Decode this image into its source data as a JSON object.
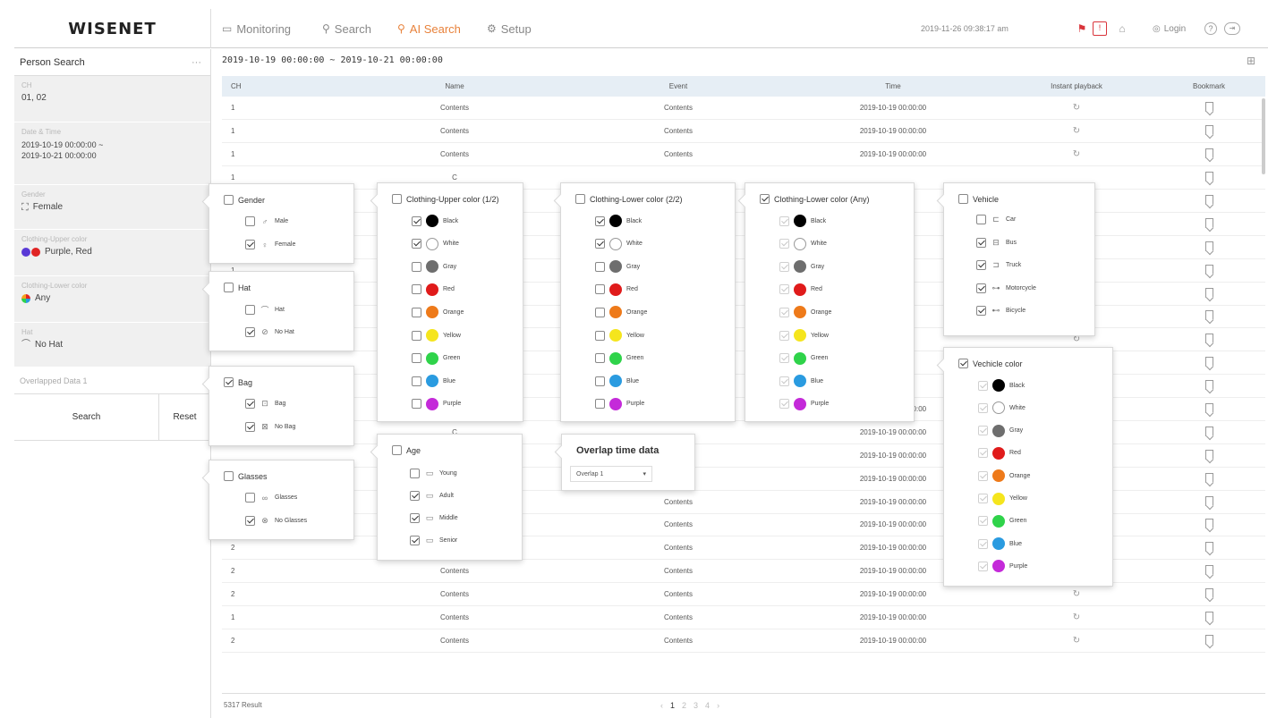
{
  "brand": "WISENET",
  "nav": {
    "monitoring": "Monitoring",
    "search": "Search",
    "ai_search": "AI Search",
    "setup": "Setup"
  },
  "header": {
    "datetime": "2019-11-26 09:38:17 am",
    "login": "Login"
  },
  "sidebar": {
    "title": "Person Search",
    "more": "···",
    "groups": [
      {
        "label": "CH",
        "value": "01, 02"
      },
      {
        "label": "Date & Time",
        "value": "2019-10-19 00:00:00 ~",
        "value2": "2019-10-21 00:00:00"
      },
      {
        "label": "Gender",
        "value": "Female",
        "icon": "person-icon"
      },
      {
        "label": "Clothing-Upper color",
        "value": "Purple, Red",
        "colors": [
          "#7b3fbf",
          "#e02424"
        ]
      },
      {
        "label": "Clothing-Lower color",
        "value": "Any",
        "icon": "color-wheel-icon"
      },
      {
        "label": "Hat",
        "value": "No Hat",
        "icon": "hat-icon"
      }
    ],
    "overlapped": "Overlapped Data 1",
    "search_button": "Search",
    "reset_button": "Reset"
  },
  "main": {
    "range": "2019-10-19 00:00:00 ~ 2019-10-21 00:00:00",
    "columns": [
      "CH",
      "Name",
      "Event",
      "Time",
      "Instant playback",
      "Bookmark"
    ],
    "rows": [
      {
        "ch": "1",
        "name": "Contents",
        "event": "Contents",
        "time": "2019-10-19 00:00:00",
        "playback": true
      },
      {
        "ch": "1",
        "name": "Contents",
        "event": "Contents",
        "time": "2019-10-19 00:00:00",
        "playback": true
      },
      {
        "ch": "1",
        "name": "Contents",
        "event": "Contents",
        "time": "2019-10-19 00:00:00",
        "playback": true
      },
      {
        "ch": "1",
        "name": "C",
        "event": "",
        "time": "",
        "playback": false
      },
      {
        "ch": "",
        "name": "C",
        "event": "",
        "time": "",
        "playback": false
      },
      {
        "ch": "",
        "name": "C",
        "event": "",
        "time": "",
        "playback": false
      },
      {
        "ch": "",
        "name": "C",
        "event": "",
        "time": "",
        "playback": false
      },
      {
        "ch": "1",
        "name": "C",
        "event": "",
        "time": "",
        "playback": false
      },
      {
        "ch": "",
        "name": "C",
        "event": "",
        "time": "",
        "playback": false
      },
      {
        "ch": "",
        "name": "C",
        "event": "",
        "time": "",
        "playback": false
      },
      {
        "ch": "",
        "name": "C",
        "event": "",
        "time": "",
        "playback": true
      },
      {
        "ch": "",
        "name": "C",
        "event": "",
        "time": "",
        "playback": true
      },
      {
        "ch": "",
        "name": "C",
        "event": "",
        "time": "",
        "playback": true
      },
      {
        "ch": "",
        "name": "Contents",
        "event": "Contents",
        "time": "2019-10-19 00:00:00",
        "playback": false
      },
      {
        "ch": "",
        "name": "C",
        "event": "",
        "time": "2019-10-19 00:00:00",
        "playback": false
      },
      {
        "ch": "",
        "name": "C",
        "event": "",
        "time": "2019-10-19 00:00:00",
        "playback": false
      },
      {
        "ch": "",
        "name": "C",
        "event": "Contents",
        "time": "2019-10-19 00:00:00",
        "playback": false
      },
      {
        "ch": "",
        "name": "C",
        "event": "Contents",
        "time": "2019-10-19 00:00:00",
        "playback": false
      },
      {
        "ch": "2",
        "name": "C",
        "event": "Contents",
        "time": "2019-10-19 00:00:00",
        "playback": false
      },
      {
        "ch": "2",
        "name": "Contents",
        "event": "Contents",
        "time": "2019-10-19 00:00:00",
        "playback": false
      },
      {
        "ch": "2",
        "name": "Contents",
        "event": "Contents",
        "time": "2019-10-19 00:00:00",
        "playback": true
      },
      {
        "ch": "2",
        "name": "Contents",
        "event": "Contents",
        "time": "2019-10-19 00:00:00",
        "playback": true
      },
      {
        "ch": "1",
        "name": "Contents",
        "event": "Contents",
        "time": "2019-10-19 00:00:00",
        "playback": true
      },
      {
        "ch": "2",
        "name": "Contents",
        "event": "Contents",
        "time": "2019-10-19 00:00:00",
        "playback": true
      }
    ],
    "result_count": "5317 Result",
    "pages": [
      "‹",
      "1",
      "2",
      "3",
      "4",
      "›"
    ]
  },
  "popups": {
    "gender": {
      "title": "Gender",
      "checked": false,
      "options": [
        {
          "label": "Male",
          "checked": false,
          "icon": "male-icon"
        },
        {
          "label": "Female",
          "checked": true,
          "icon": "female-icon"
        }
      ]
    },
    "hat": {
      "title": "Hat",
      "checked": false,
      "options": [
        {
          "label": "Hat",
          "checked": false,
          "icon": "hat-icon"
        },
        {
          "label": "No Hat",
          "checked": true,
          "icon": "no-hat-icon"
        }
      ]
    },
    "bag": {
      "title": "Bag",
      "checked": true,
      "options": [
        {
          "label": "Bag",
          "checked": true,
          "icon": "bag-icon"
        },
        {
          "label": "No Bag",
          "checked": true,
          "icon": "no-bag-icon"
        }
      ]
    },
    "glasses": {
      "title": "Glasses",
      "checked": false,
      "options": [
        {
          "label": "Glasses",
          "checked": false,
          "icon": "glasses-icon"
        },
        {
          "label": "No Glasses",
          "checked": true,
          "icon": "no-glasses-icon"
        }
      ]
    },
    "upper_color": {
      "title": "Clothing-Upper color (1/2)",
      "checked": false,
      "options": [
        {
          "label": "Black",
          "checked": true,
          "color": "#000000"
        },
        {
          "label": "White",
          "checked": true,
          "color": "#ffffff"
        },
        {
          "label": "Gray",
          "checked": false,
          "color": "#6e6e6e"
        },
        {
          "label": "Red",
          "checked": false,
          "color": "#e01b1b"
        },
        {
          "label": "Orange",
          "checked": false,
          "color": "#ee7a1a"
        },
        {
          "label": "Yellow",
          "checked": false,
          "color": "#f5e51d"
        },
        {
          "label": "Green",
          "checked": false,
          "color": "#2fd34a"
        },
        {
          "label": "Blue",
          "checked": false,
          "color": "#2a9be0"
        },
        {
          "label": "Purple",
          "checked": false,
          "color": "#c42ad9"
        }
      ]
    },
    "lower_color": {
      "title": "Clothing-Lower color (2/2)",
      "checked": false,
      "options": [
        {
          "label": "Black",
          "checked": true,
          "color": "#000000"
        },
        {
          "label": "White",
          "checked": true,
          "color": "#ffffff"
        },
        {
          "label": "Gray",
          "checked": false,
          "color": "#6e6e6e"
        },
        {
          "label": "Red",
          "checked": false,
          "color": "#e01b1b"
        },
        {
          "label": "Orange",
          "checked": false,
          "color": "#ee7a1a"
        },
        {
          "label": "Yellow",
          "checked": false,
          "color": "#f5e51d"
        },
        {
          "label": "Green",
          "checked": false,
          "color": "#2fd34a"
        },
        {
          "label": "Blue",
          "checked": false,
          "color": "#2a9be0"
        },
        {
          "label": "Purple",
          "checked": false,
          "color": "#c42ad9"
        }
      ]
    },
    "lower_color_any": {
      "title": "Clothing-Lower color (Any)",
      "checked": true,
      "options": [
        {
          "label": "Black",
          "checked": true,
          "color": "#000000"
        },
        {
          "label": "White",
          "checked": true,
          "color": "#ffffff"
        },
        {
          "label": "Gray",
          "checked": true,
          "color": "#6e6e6e"
        },
        {
          "label": "Red",
          "checked": true,
          "color": "#e01b1b"
        },
        {
          "label": "Orange",
          "checked": true,
          "color": "#ee7a1a"
        },
        {
          "label": "Yellow",
          "checked": true,
          "color": "#f5e51d"
        },
        {
          "label": "Green",
          "checked": true,
          "color": "#2fd34a"
        },
        {
          "label": "Blue",
          "checked": true,
          "color": "#2a9be0"
        },
        {
          "label": "Purple",
          "checked": true,
          "color": "#c42ad9"
        }
      ]
    },
    "vehicle": {
      "title": "Vehicle",
      "checked": false,
      "options": [
        {
          "label": "Car",
          "checked": false,
          "icon": "car-icon"
        },
        {
          "label": "Bus",
          "checked": true,
          "icon": "bus-icon"
        },
        {
          "label": "Truck",
          "checked": true,
          "icon": "truck-icon"
        },
        {
          "label": "Motorcycle",
          "checked": true,
          "icon": "motorcycle-icon"
        },
        {
          "label": "Bicycle",
          "checked": true,
          "icon": "bicycle-icon"
        }
      ]
    },
    "vehicle_color": {
      "title": "Vechicle color",
      "checked": true,
      "options": [
        {
          "label": "Black",
          "checked": true,
          "color": "#000000"
        },
        {
          "label": "White",
          "checked": true,
          "color": "#ffffff"
        },
        {
          "label": "Gray",
          "checked": true,
          "color": "#6e6e6e"
        },
        {
          "label": "Red",
          "checked": true,
          "color": "#e01b1b"
        },
        {
          "label": "Orange",
          "checked": true,
          "color": "#ee7a1a"
        },
        {
          "label": "Yellow",
          "checked": true,
          "color": "#f5e51d"
        },
        {
          "label": "Green",
          "checked": true,
          "color": "#2fd34a"
        },
        {
          "label": "Blue",
          "checked": true,
          "color": "#2a9be0"
        },
        {
          "label": "Purple",
          "checked": true,
          "color": "#c42ad9"
        }
      ]
    },
    "age": {
      "title": "Age",
      "checked": false,
      "options": [
        {
          "label": "Young",
          "checked": false,
          "icon": "young-icon"
        },
        {
          "label": "Adult",
          "checked": true,
          "icon": "adult-icon"
        },
        {
          "label": "Middle",
          "checked": true,
          "icon": "middle-icon"
        },
        {
          "label": "Senior",
          "checked": true,
          "icon": "senior-icon"
        }
      ]
    },
    "overlap": {
      "title": "Overlap time data",
      "selected": "Overlap 1"
    }
  },
  "colors": {
    "accent": "#e8823b",
    "header_row": "#e6eef5",
    "sidebar_bg": "#f0f0f0"
  }
}
